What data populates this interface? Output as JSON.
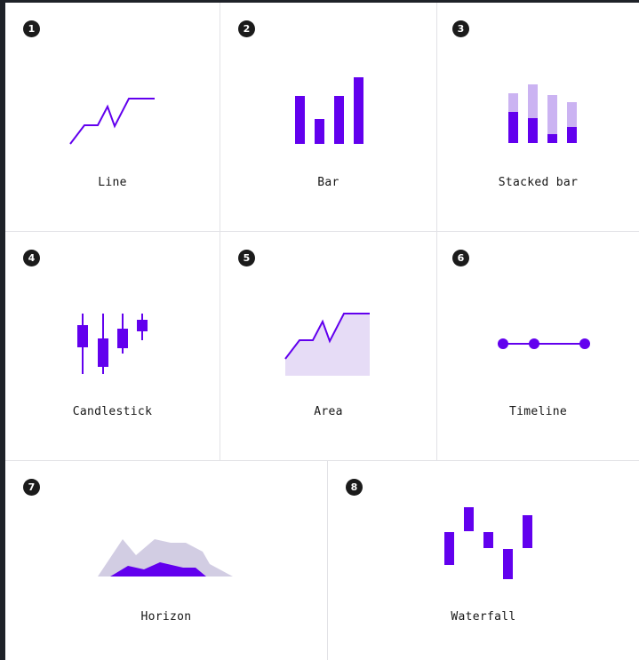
{
  "colors": {
    "primary": "#6200ee",
    "light": "#cbb3f2",
    "area_fill": "#e6dcf6",
    "horizon_back": "#d2cde3",
    "badge_bg": "#1b1b1b",
    "divider": "#e2e2e6"
  },
  "cards": [
    {
      "number": "1",
      "label": "Line",
      "icon": "line-chart-icon"
    },
    {
      "number": "2",
      "label": "Bar",
      "icon": "bar-chart-icon"
    },
    {
      "number": "3",
      "label": "Stacked bar",
      "icon": "stacked-bar-chart-icon"
    },
    {
      "number": "4",
      "label": "Candlestick",
      "icon": "candlestick-chart-icon"
    },
    {
      "number": "5",
      "label": "Area",
      "icon": "area-chart-icon"
    },
    {
      "number": "6",
      "label": "Timeline",
      "icon": "timeline-chart-icon"
    },
    {
      "number": "7",
      "label": "Horizon",
      "icon": "horizon-chart-icon"
    },
    {
      "number": "8",
      "label": "Waterfall",
      "icon": "waterfall-chart-icon"
    }
  ]
}
